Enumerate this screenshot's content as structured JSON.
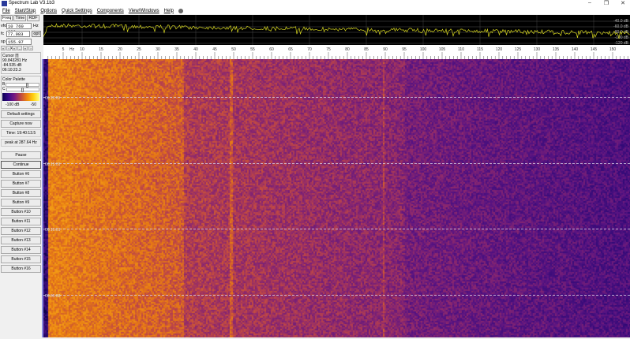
{
  "window": {
    "title": "Spectrum Lab V3.1b3",
    "controls": [
      "–",
      "❐",
      "✕"
    ]
  },
  "menu": [
    "File",
    "Start/Stop",
    "Options",
    "Quick Settings",
    "Components",
    "View/Windows",
    "Help"
  ],
  "left": {
    "tabs": [
      "Freq",
      "Time",
      "RDF"
    ],
    "vfo": {
      "label": "vfo",
      "value": "10 760 000",
      "unit": "Hz"
    },
    "fc": {
      "label": "fc",
      "value": "77.983 Hz",
      "btn": "opt"
    },
    "sp": {
      "label": "sp",
      "value": "155.97 Hz"
    },
    "nav": [
      "«",
      "‹",
      "«",
      "‒",
      "»",
      "›"
    ],
    "cursor": {
      "title": "Cursor [f]",
      "freq": "90.843281 Hz",
      "level": "-84.535 dB",
      "time": "06:10:23.3"
    },
    "palette": {
      "title": "Color Palette",
      "b": "B",
      "c": "C",
      "min": "-100 dB",
      "max": "-50",
      "b_level": 0.6,
      "c_level": 0.45
    },
    "buttons": [
      "Default settings",
      "Capture now",
      "Time:  19:40:13.5",
      "peak at 287.64 Hz",
      "Pause",
      "Continue",
      "Button #6",
      "Button #7",
      "Button #8",
      "Button #9",
      "Button #10",
      "Button #11",
      "Button #12",
      "Button #13",
      "Button #14",
      "Button #15",
      "Button #16"
    ]
  },
  "spectrum": {
    "db_labels": [
      "-40.0 dB",
      "-60.0 dB",
      "-80.0 dB",
      "-100 dB",
      "-120 dB"
    ],
    "trace_color": "#d8d820"
  },
  "axis": {
    "unit": "Hz",
    "ticks": [
      5,
      10,
      15,
      20,
      25,
      30,
      35,
      40,
      45,
      50,
      55,
      60,
      65,
      70,
      75,
      80,
      85,
      90,
      95,
      100,
      105,
      110,
      115,
      120,
      125,
      130,
      135,
      140,
      145,
      150
    ]
  },
  "waterfall": {
    "timestamps": [
      "06:20:01",
      "06:15:01",
      "06:10:01",
      "06:05:00"
    ]
  }
}
